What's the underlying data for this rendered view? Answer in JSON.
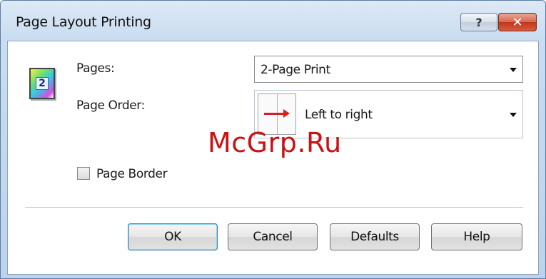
{
  "window": {
    "title": "Page Layout Printing",
    "help_button": "?",
    "close_button": "✕"
  },
  "pages": {
    "icon_label": "2",
    "label": "Pages:",
    "selected": "2-Page Print"
  },
  "page_order": {
    "label": "Page Order:",
    "selected": "Left to right"
  },
  "page_border": {
    "label": "Page Border",
    "checked": false
  },
  "buttons": {
    "ok": "OK",
    "cancel": "Cancel",
    "defaults": "Defaults",
    "help": "Help"
  },
  "watermark": "McGrp.Ru"
}
